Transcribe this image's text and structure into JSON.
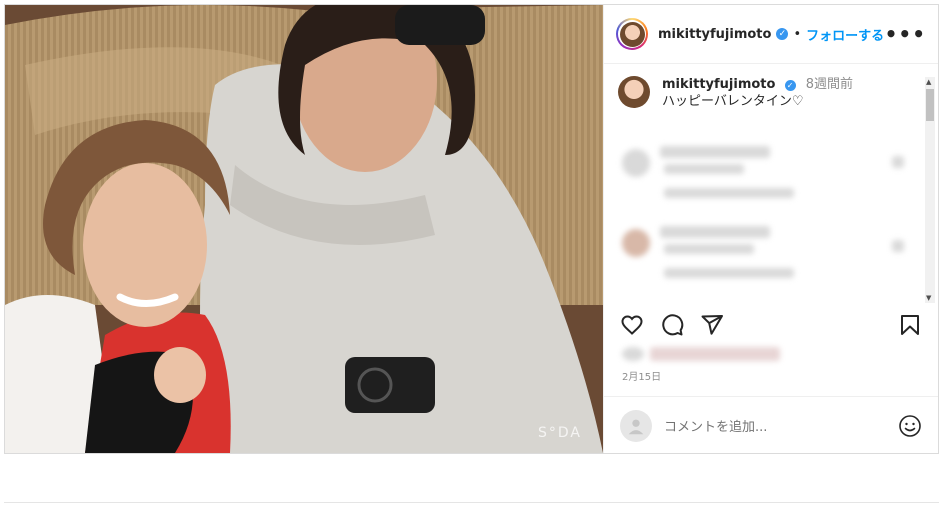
{
  "post": {
    "username": "mikittyfujimoto",
    "follow_label": "フォローする",
    "separator": "•",
    "more_label": "•••",
    "caption": {
      "username": "mikittyfujimoto",
      "time": "8週間前",
      "text": "ハッピーバレンタイン♡"
    },
    "date": "2月15日",
    "comment_placeholder": "コメントを追加...",
    "photo_watermark": "S°DA"
  },
  "colors": {
    "accent": "#0095f6",
    "verified": "#3897f0"
  },
  "icons": [
    "heart-icon",
    "comment-icon",
    "share-icon",
    "bookmark-icon",
    "emoji-icon",
    "more-icon",
    "verified-icon"
  ]
}
